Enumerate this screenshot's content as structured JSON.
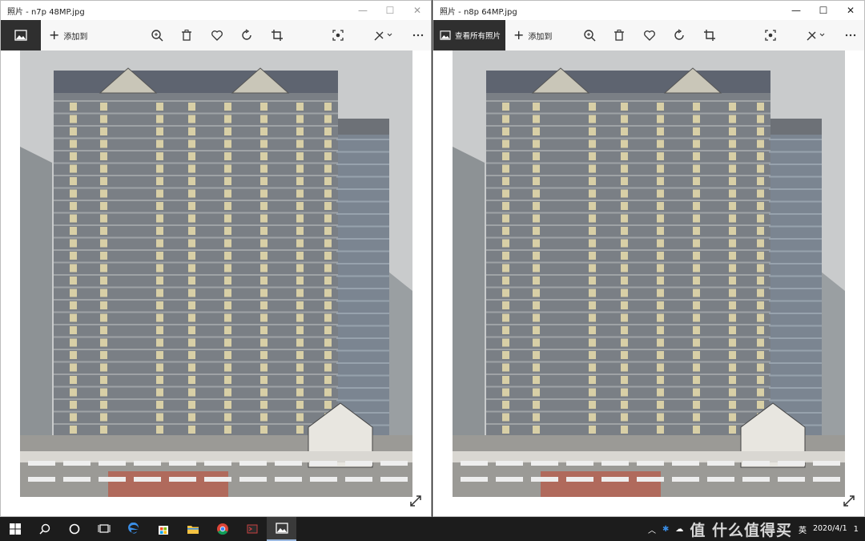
{
  "left_window": {
    "title": "照片 - n7p 48MP.jpg",
    "add_label": "添加到"
  },
  "right_window": {
    "title": "照片 - n8p 64MP.jpg",
    "home_label": "查看所有照片",
    "add_label": "添加到"
  },
  "caption": {
    "minimize": "—",
    "maximize": "☐",
    "close": "✕"
  },
  "toolbar_icons": [
    "zoom-icon",
    "delete-icon",
    "favorite-icon",
    "rotate-icon",
    "crop-icon",
    "enhance-icon",
    "edit-icon",
    "more-icon"
  ],
  "taskbar": {
    "apps": [
      "start",
      "search",
      "cortana",
      "task-view",
      "edge",
      "store",
      "explorer",
      "chrome",
      "app",
      "photos"
    ],
    "tray": {
      "ime": "英",
      "date": "2020/4/1",
      "notification_count": "1"
    }
  },
  "watermark": "值 什么值得买",
  "colors": {
    "toolbar_dark": "#2f2f2f",
    "taskbar": "#1c1c1c"
  }
}
